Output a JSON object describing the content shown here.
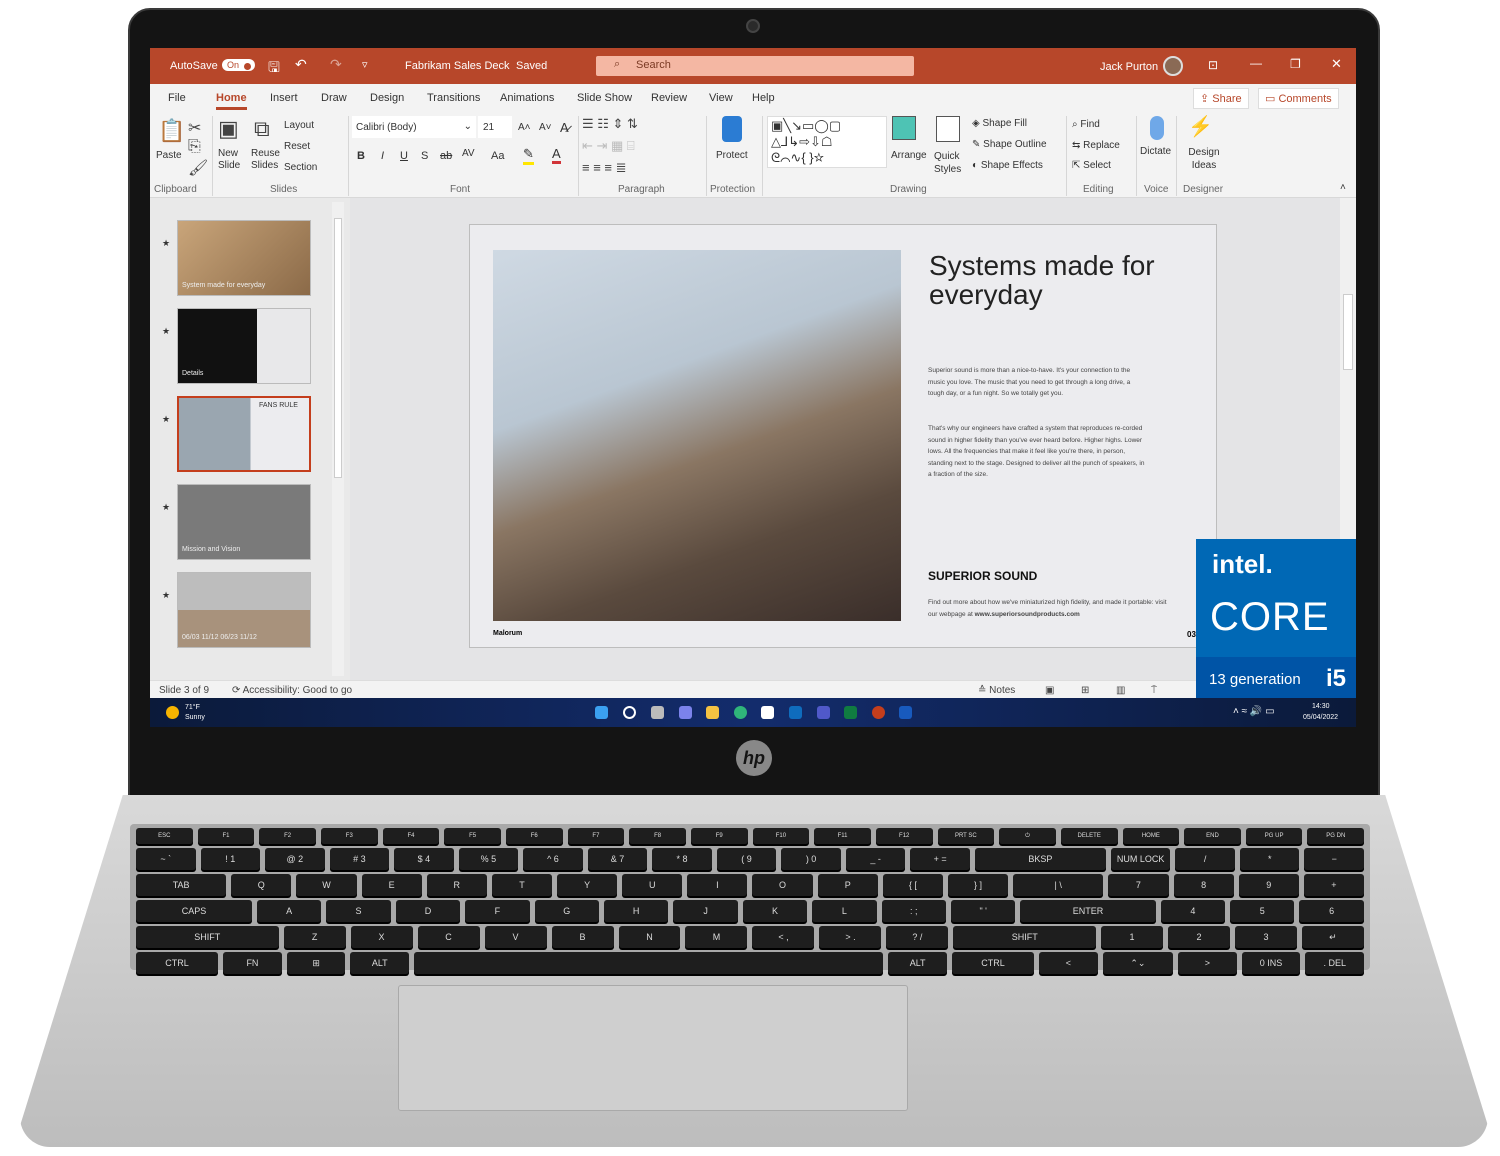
{
  "window": {
    "autosave_label": "AutoSave",
    "autosave_state": "On",
    "doc_title": "Fabrikam Sales Deck",
    "save_status": "Saved",
    "search_placeholder": "Search",
    "user_name": "Jack Purton",
    "brand_color": "#b7472a"
  },
  "tabs": [
    "File",
    "Home",
    "Insert",
    "Draw",
    "Design",
    "Transitions",
    "Animations",
    "Slide Show",
    "Review",
    "View",
    "Help"
  ],
  "active_tab": "Home",
  "share_label": "Share",
  "comments_label": "Comments",
  "ribbon": {
    "clipboard": {
      "paste": "Paste",
      "group": "Clipboard"
    },
    "slides": {
      "new_slide": "New Slide",
      "reuse_slides": "Reuse Slides",
      "layout": "Layout",
      "reset": "Reset",
      "section": "Section",
      "group": "Slides"
    },
    "font": {
      "font_name": "Calibri (Body)",
      "font_size": "21",
      "bold": "B",
      "italic": "I",
      "underline": "U",
      "shadow": "S",
      "strike": "ab",
      "spacing": "AV",
      "case": "Aa",
      "group": "Font"
    },
    "paragraph": {
      "group": "Paragraph"
    },
    "protection": {
      "protect": "Protect",
      "group": "Protection"
    },
    "drawing": {
      "arrange": "Arrange",
      "quick_styles": "Quick Styles",
      "shape_fill": "Shape Fill",
      "shape_outline": "Shape Outline",
      "shape_effects": "Shape Effects",
      "group": "Drawing"
    },
    "editing": {
      "find": "Find",
      "replace": "Replace",
      "select": "Select",
      "group": "Editing"
    },
    "voice": {
      "dictate": "Dictate",
      "group": "Voice"
    },
    "designer": {
      "design_ideas": "Design Ideas",
      "group": "Designer"
    }
  },
  "thumbnails": [
    {
      "text": "System made for everyday"
    },
    {
      "text": "Details"
    },
    {
      "text": "FANS RULE",
      "selected": true
    },
    {
      "text": "Mission and Vision"
    },
    {
      "text": "06/03   11/12   06/23   11/12"
    }
  ],
  "slide": {
    "headline": "Systems made for everyday",
    "para1": "Superior sound is more than a nice-to-have. It's your connection to the music you love. The music that you need to get through a long drive, a tough day, or a fun night. So we totally get you.",
    "para2": "That's why our engineers have crafted a system that reproduces re-corded sound in higher fidelity than you've ever heard before. Higher highs. Lower lows. All the frequencies that make it feel like you're there, in person, standing next to the stage. Designed to deliver all the punch of speakers, in a fraction of the size.",
    "subheading": "SUPERIOR SOUND",
    "footer_text": "Find out more about how we've miniaturized high fidelity, and made it portable: visit our webpage at",
    "footer_link": "www.superiorsoundproducts.com",
    "caption": "Malorum",
    "page_number": "03"
  },
  "status": {
    "slide_counter": "Slide 3 of 9",
    "accessibility": "Accessibility: Good to go",
    "notes": "Notes"
  },
  "taskbar": {
    "temperature": "71°F",
    "weather": "Sunny",
    "time": "14:30",
    "date": "05/04/2022"
  },
  "intel_badge": {
    "brand": "intel.",
    "product": "CORE",
    "generation": "13 generation",
    "tier": "i5"
  },
  "laptop_logo": "hp",
  "keyboard": [
    [
      "ESC",
      "F1",
      "F2",
      "F3",
      "F4",
      "F5",
      "F6",
      "F7",
      "F8",
      "F9",
      "F10",
      "F11",
      "F12",
      "PRT SC",
      "⏻",
      "DELETE",
      "HOME",
      "END",
      "PG UP",
      "PG DN"
    ],
    [
      "~ `",
      "! 1",
      "@ 2",
      "# 3",
      "$ 4",
      "% 5",
      "^ 6",
      "& 7",
      "* 8",
      "( 9",
      ") 0",
      "_ -",
      "+ =",
      "BKSP",
      "NUM LOCK",
      "/",
      "*",
      "−"
    ],
    [
      "TAB",
      "Q",
      "W",
      "E",
      "R",
      "T",
      "Y",
      "U",
      "I",
      "O",
      "P",
      "{ [",
      "} ]",
      "| \\",
      "7",
      "8",
      "9",
      "+"
    ],
    [
      "CAPS",
      "A",
      "S",
      "D",
      "F",
      "G",
      "H",
      "J",
      "K",
      "L",
      ": ;",
      "\" '",
      "ENTER",
      "4",
      "5",
      "6"
    ],
    [
      "SHIFT",
      "Z",
      "X",
      "C",
      "V",
      "B",
      "N",
      "M",
      "< ,",
      "> .",
      "? /",
      "SHIFT",
      "1",
      "2",
      "3",
      "↵"
    ],
    [
      "CTRL",
      "FN",
      "⊞",
      "ALT",
      "",
      "ALT",
      "CTRL",
      "<",
      "⌃⌄",
      ">",
      "0 INS",
      ". DEL"
    ]
  ]
}
